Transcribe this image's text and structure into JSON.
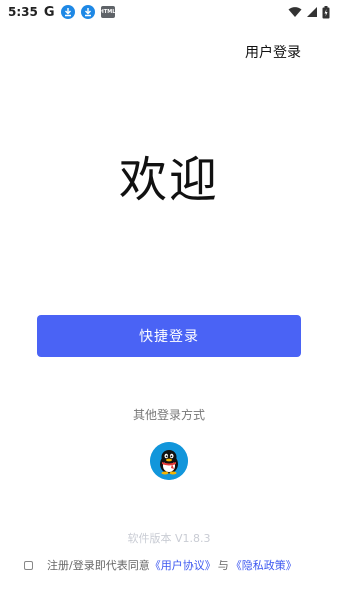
{
  "status_bar": {
    "time": "5:35",
    "google_letter": "G",
    "html_badge": "HTML"
  },
  "header": {
    "user_login_label": "用户登录"
  },
  "main": {
    "welcome_text": "欢迎",
    "quick_login_label": "快捷登录",
    "other_login_label": "其他登录方式",
    "other_login_icons": [
      "qq-icon"
    ]
  },
  "footer": {
    "version": "软件版本 V1.8.3",
    "agreement_prefix": "注册/登录即代表同意",
    "user_agreement_link": "《用户协议》",
    "agreement_and": "与",
    "privacy_policy_link": "《隐私政策》"
  },
  "colors": {
    "primary": "#4a63f5",
    "link": "#3c57f0",
    "qq_blue": "#1296db"
  }
}
